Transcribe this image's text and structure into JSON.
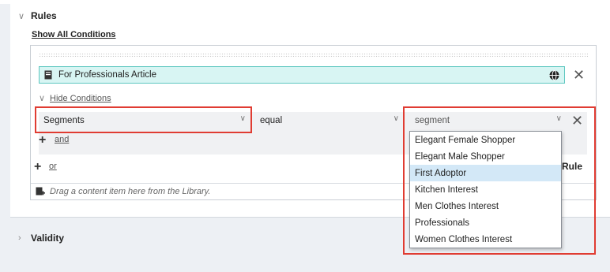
{
  "rules": {
    "title": "Rules",
    "show_all_conditions": "Show All Conditions",
    "hide_conditions": "Hide Conditions",
    "content_item": "For Professionals Article",
    "condition": {
      "field": "Segments",
      "operator": "equal",
      "value_placeholder": "segment"
    },
    "and_label": "and",
    "or_label": "or",
    "rule_label": "Rule",
    "drop_hint": "Drag a content item here from the Library."
  },
  "segment_options": [
    "Elegant Female Shopper",
    "Elegant Male Shopper",
    "First Adoptor",
    "Kitchen Interest",
    "Men Clothes Interest",
    "Professionals",
    "Women Clothes Interest"
  ],
  "hovered_option": "First Adoptor",
  "validity": {
    "title": "Validity"
  },
  "colors": {
    "highlight": "#e03c32",
    "content_bar": "#d8f5f3",
    "option_hover": "#d3e8f7"
  }
}
